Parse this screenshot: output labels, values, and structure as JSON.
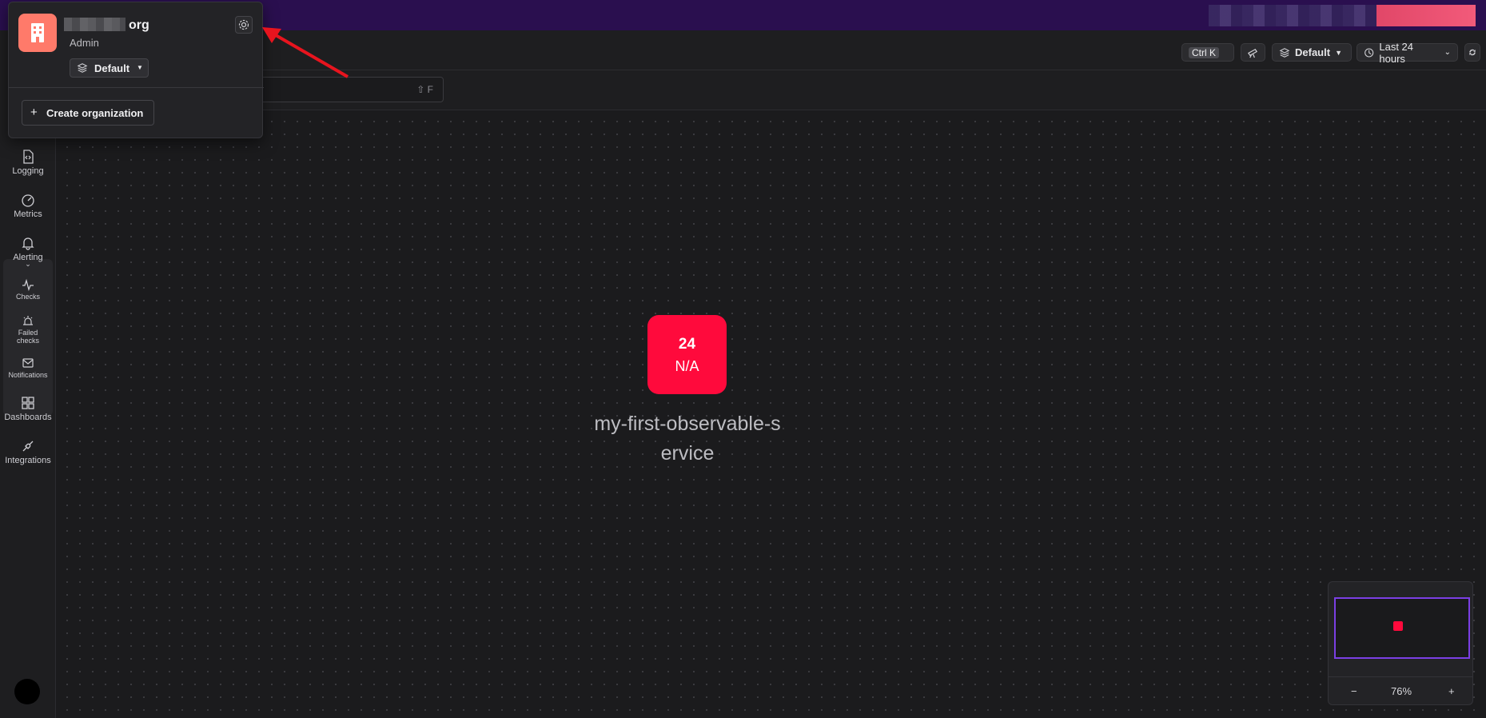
{
  "org": {
    "name_suffix": "org",
    "role": "Admin",
    "environment": "Default",
    "create_label": "Create organization",
    "logo_color": "#ff7a6a"
  },
  "header": {
    "shortcut": "Ctrl K",
    "environment": "Default",
    "time_range": "Last 24 hours"
  },
  "search": {
    "shortcut_hint": "⇧ F"
  },
  "sidebar": {
    "items": [
      {
        "label": "Logging",
        "icon": "logging-icon"
      },
      {
        "label": "Metrics",
        "icon": "gauge-icon"
      },
      {
        "label": "Alerting",
        "icon": "bell-icon"
      },
      {
        "label": "Checks",
        "icon": "pulse-icon"
      },
      {
        "label": "Failed checks",
        "icon": "siren-icon"
      },
      {
        "label": "Notifications",
        "icon": "mail-icon"
      },
      {
        "label": "Dashboards",
        "icon": "grid-icon"
      },
      {
        "label": "Integrations",
        "icon": "plug-icon"
      }
    ]
  },
  "canvas": {
    "node": {
      "value": "24",
      "status": "N/A",
      "name": "my-first-observable-service",
      "color": "#ff0a3c"
    }
  },
  "minimap": {
    "zoom": "76%",
    "minus": "−",
    "plus": "+",
    "viewport_color": "#7b3fe4"
  },
  "colors": {
    "banner": "#2a0f4f",
    "annotation_arrow": "#e8141e"
  }
}
